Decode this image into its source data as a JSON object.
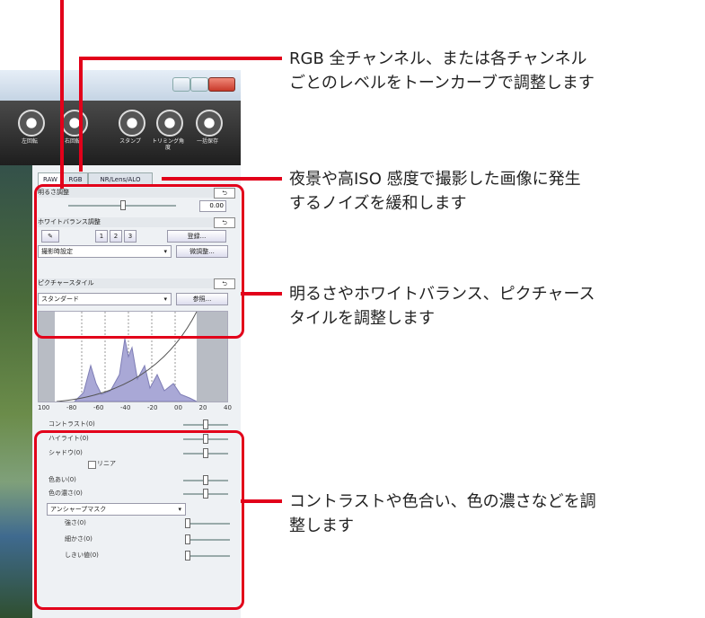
{
  "annotations": {
    "rgb": [
      "RGB 全チャンネル、または各チャンネル",
      "ごとのレベルをトーンカーブで調整します"
    ],
    "noise": [
      "夜景や高ISO 感度で撮影した画像に発生",
      "するノイズを緩和します"
    ],
    "brightness": [
      "明るさやホワイトバランス、ピクチャース",
      "タイルを調整します"
    ],
    "contrast": [
      "コントラストや色合い、色の濃さなどを調",
      "整します"
    ]
  },
  "toolbar": {
    "tools": [
      {
        "label": "左回転",
        "icon": "rotate-left-icon"
      },
      {
        "label": "右回転",
        "icon": "rotate-right-icon"
      },
      {
        "label": "スタンプ",
        "icon": "stamp-icon"
      },
      {
        "label": "トリミング角度",
        "icon": "trim-icon"
      },
      {
        "label": "一括保存",
        "icon": "batch-save-icon"
      }
    ]
  },
  "tabs": [
    "RAW",
    "RGB",
    "NR/Lens/ALO"
  ],
  "brightness": {
    "title": "明るさ調整",
    "value": "0.00",
    "reset": "⮌"
  },
  "white_balance": {
    "title": "ホワイトバランス調整",
    "presets": [
      "1",
      "2",
      "3"
    ],
    "register": "登録...",
    "mode": "撮影時設定",
    "fine": "微調整...",
    "reset": "⮌"
  },
  "picture_style": {
    "title": "ピクチャースタイル",
    "value": "スタンダード",
    "browse": "参照...",
    "reset": "⮌"
  },
  "histogram_axis": [
    "100",
    "-80",
    "-60",
    "-40",
    "-20",
    "00",
    "20",
    "40"
  ],
  "adjust": {
    "contrast": "コントラスト(0)",
    "highlight": "ハイライト(0)",
    "shadow": "シャドウ(0)",
    "linear": "リニア",
    "hue": "色あい(0)",
    "saturation": "色の濃さ(0)",
    "sharpness_mode": "アンシャープマスク",
    "strength": "強さ(0)",
    "fineness": "細かさ(0)",
    "threshold": "しきい値(0)"
  }
}
